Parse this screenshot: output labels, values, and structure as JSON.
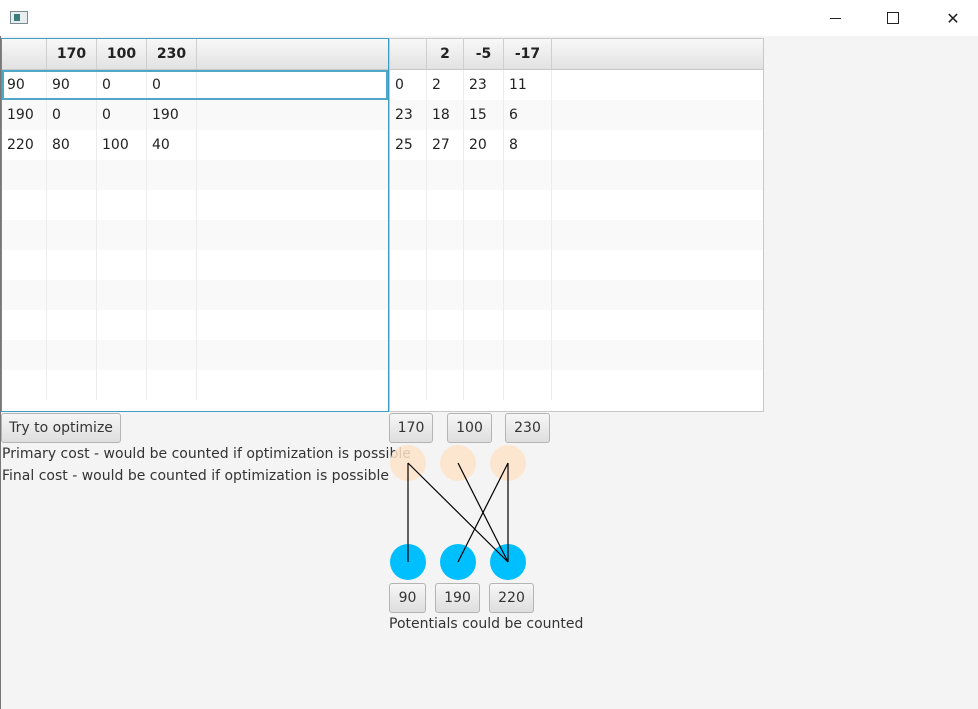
{
  "window": {
    "minimize_glyph": "",
    "close_glyph": "✕"
  },
  "left_table": {
    "headers": [
      "",
      "170",
      "100",
      "230",
      ""
    ],
    "rows": [
      [
        "90",
        "90",
        "0",
        "0",
        ""
      ],
      [
        "190",
        "0",
        "0",
        "190",
        ""
      ],
      [
        "220",
        "80",
        "100",
        "40",
        ""
      ]
    ],
    "empty_rows": 8
  },
  "right_table": {
    "headers": [
      "",
      "2",
      "-5",
      "-17",
      ""
    ],
    "rows": [
      [
        "0",
        "2",
        "23",
        "11",
        ""
      ],
      [
        "23",
        "18",
        "15",
        "6",
        ""
      ],
      [
        "25",
        "27",
        "20",
        "8",
        ""
      ]
    ],
    "empty_rows": 8
  },
  "optimize_button": "Try to optimize",
  "primary_cost": "Primary cost - would be counted if optimization is possible",
  "final_cost": "Final cost - would be counted if optimization is possible",
  "supply_buttons": [
    "170",
    "100",
    "230"
  ],
  "demand_buttons": [
    "90",
    "190",
    "220"
  ],
  "potentials_text": "Potentials could be counted",
  "graph": {
    "top_node_color": "#fde3c8",
    "bottom_node_color": "#00bfff",
    "edges": [
      [
        0,
        0
      ],
      [
        0,
        2
      ],
      [
        1,
        2
      ],
      [
        2,
        1
      ],
      [
        2,
        2
      ]
    ]
  }
}
